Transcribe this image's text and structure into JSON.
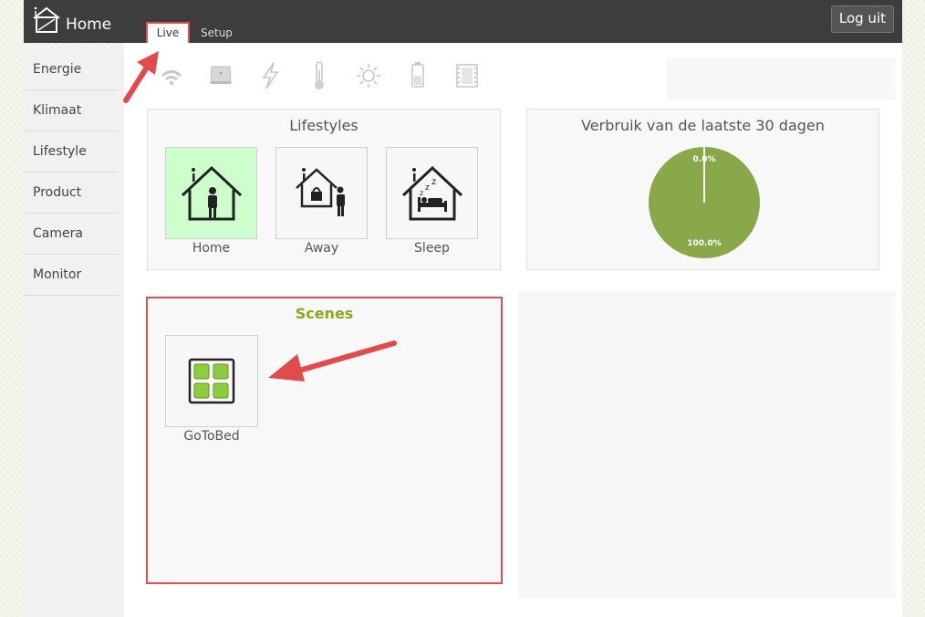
{
  "header": {
    "app_title": "Home",
    "tabs": [
      {
        "label": "Live",
        "active": true
      },
      {
        "label": "Setup",
        "active": false
      }
    ],
    "logout_label": "Log uit"
  },
  "sidebar": {
    "items": [
      {
        "label": "Energie"
      },
      {
        "label": "Klimaat"
      },
      {
        "label": "Lifestyle"
      },
      {
        "label": "Product"
      },
      {
        "label": "Camera"
      },
      {
        "label": "Monitor"
      }
    ]
  },
  "toolbar_icons": [
    "wifi-icon",
    "device-icon",
    "lightning-icon",
    "thermometer-icon",
    "sun-icon",
    "battery-icon",
    "film-icon"
  ],
  "lifestyles": {
    "title": "Lifestyles",
    "cards": [
      {
        "label": "Home",
        "icon": "home-person-icon",
        "active": true
      },
      {
        "label": "Away",
        "icon": "home-lock-icon",
        "active": false
      },
      {
        "label": "Sleep",
        "icon": "home-sleep-icon",
        "active": false
      }
    ]
  },
  "usage": {
    "title": "Verbruik van de laatste 30 dagen"
  },
  "chart_data": {
    "type": "pie",
    "title": "Verbruik van de laatste 30 dagen",
    "slices": [
      {
        "label": "0.0%",
        "value": 0.0
      },
      {
        "label": "100.0%",
        "value": 100.0
      }
    ],
    "colors": [
      "#ffffff",
      "#88a84a"
    ]
  },
  "scenes": {
    "title": "Scenes",
    "items": [
      {
        "label": "GoToBed",
        "icon": "scene-grid-icon"
      }
    ]
  },
  "colors": {
    "topbar": "#3d3d3d",
    "highlight": "#e05050",
    "active_lifestyle": "#ccffcc",
    "scenes_title": "#8aaa18",
    "pie": "#88a84a"
  }
}
